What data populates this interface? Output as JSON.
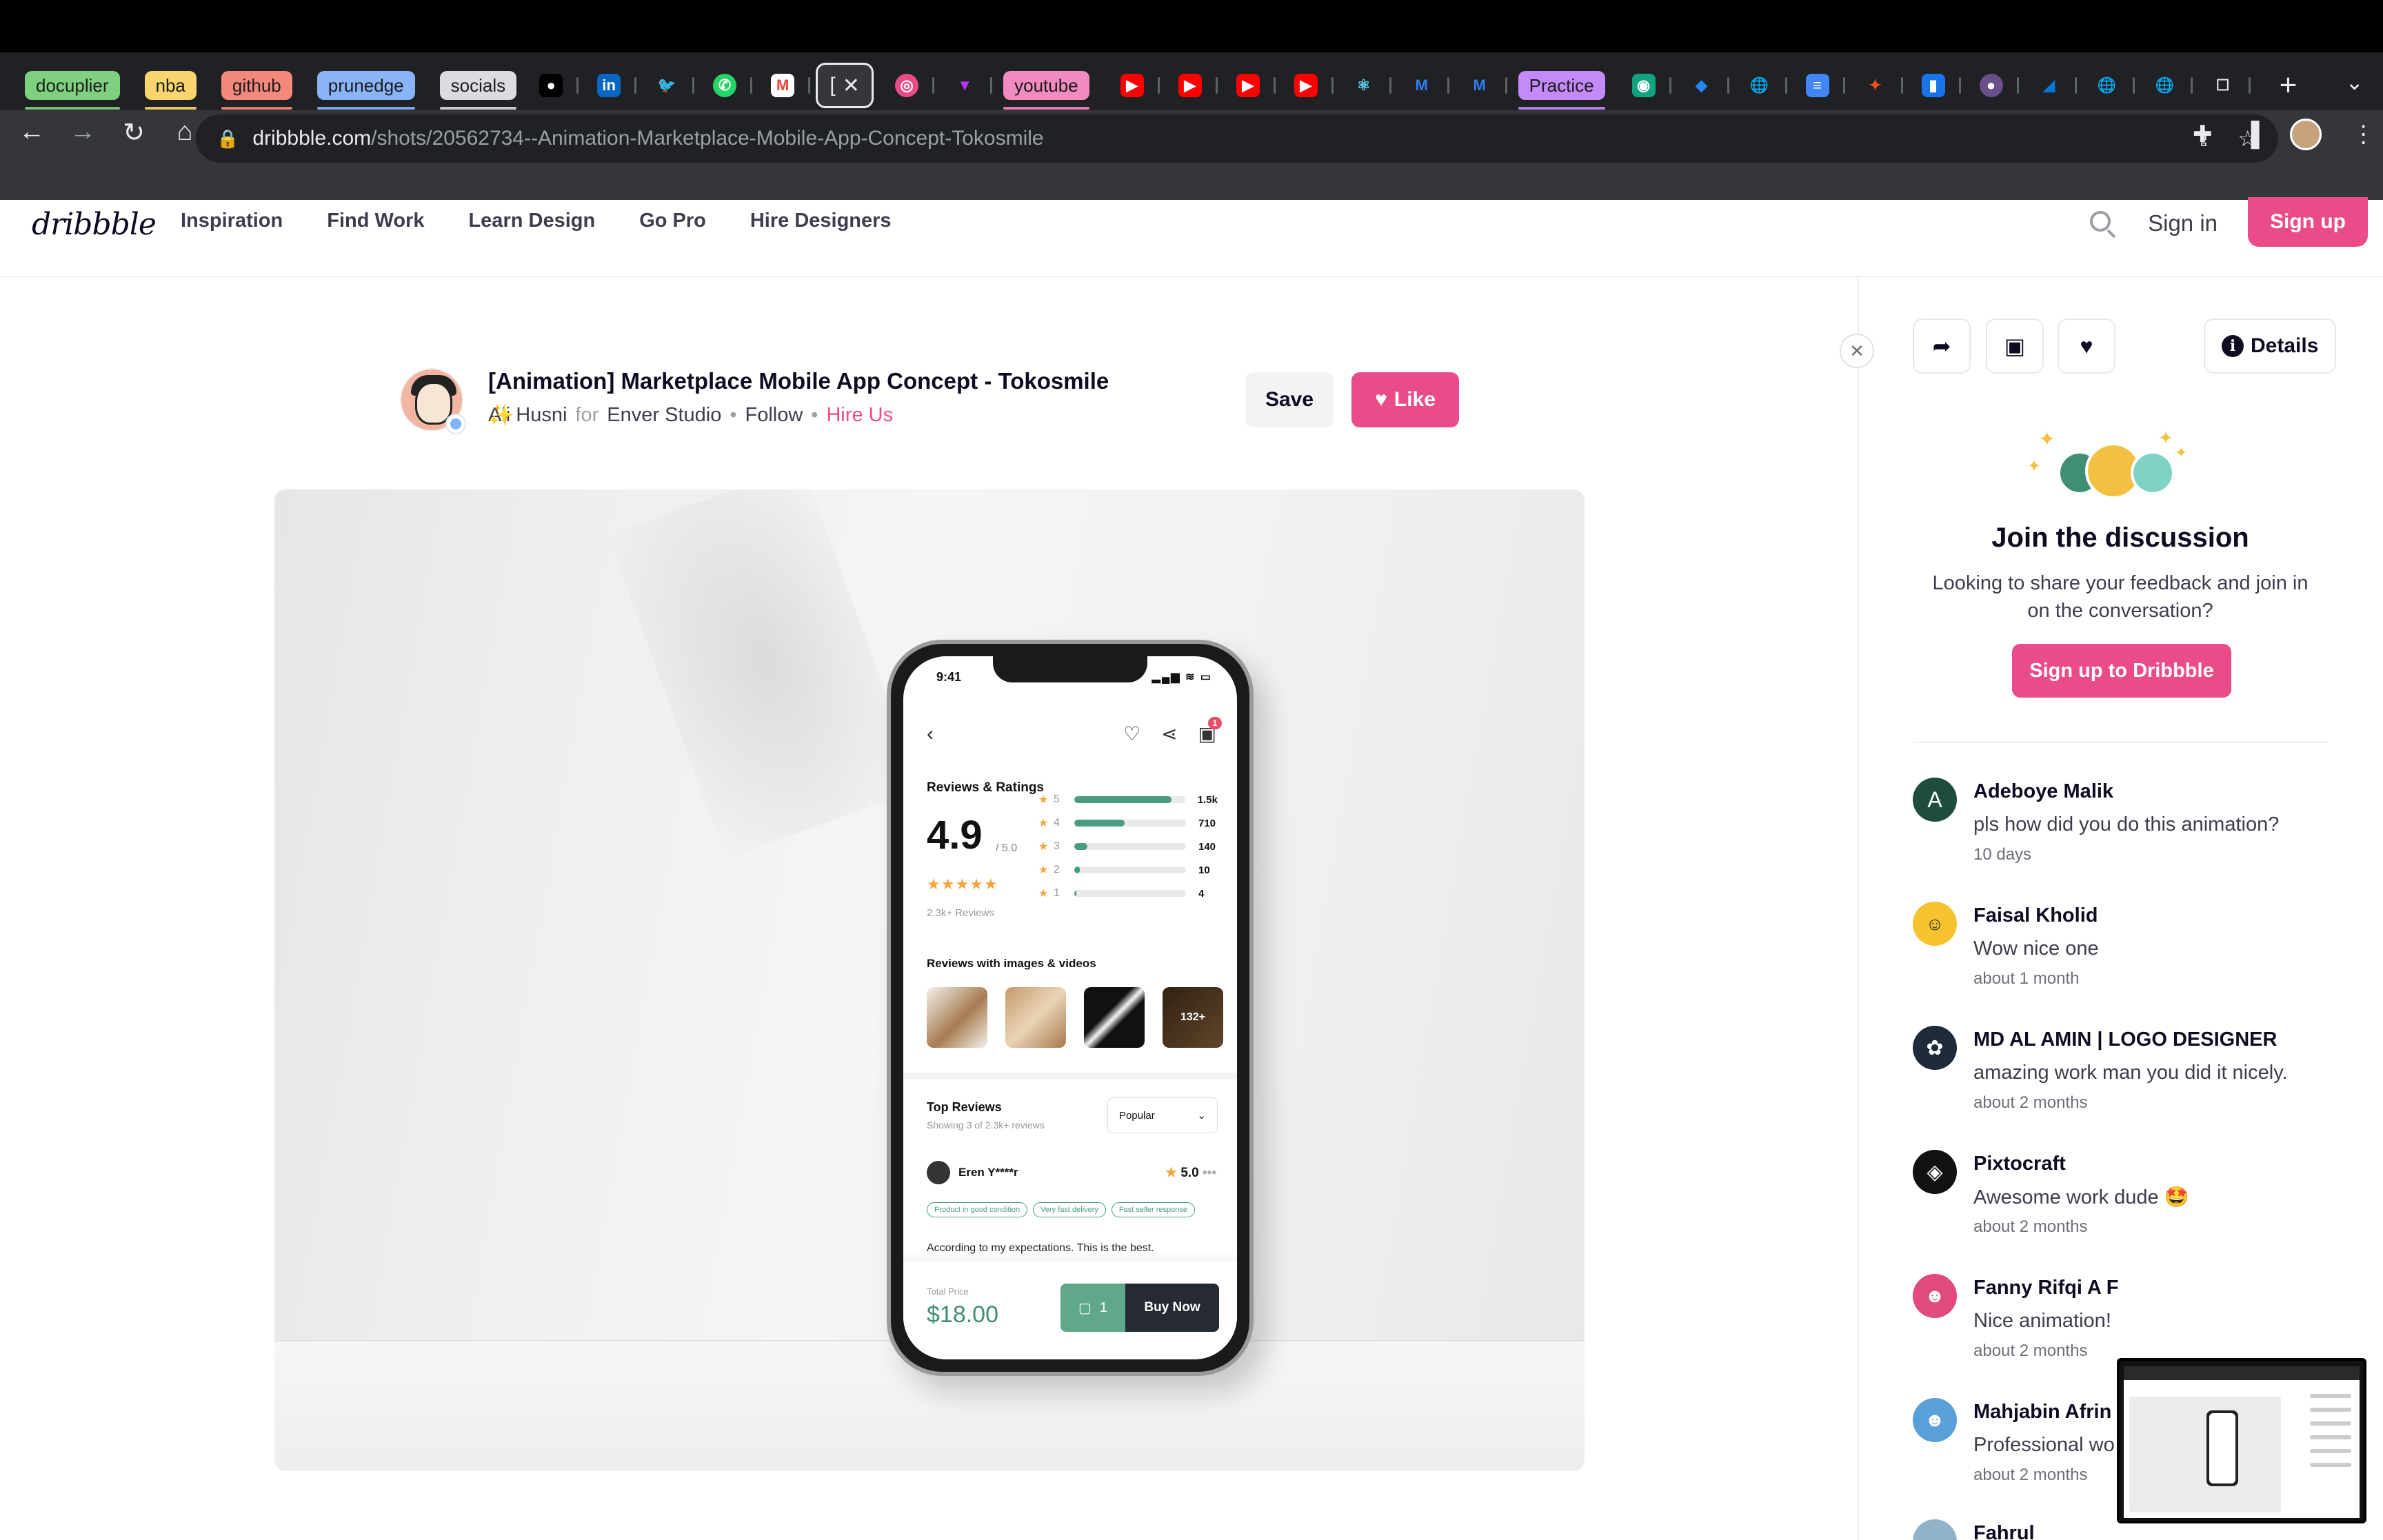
{
  "browser": {
    "tab_groups": [
      {
        "label": "docuplier",
        "color": "#7fd17f"
      },
      {
        "label": "nba",
        "color": "#f9d56e"
      },
      {
        "label": "github",
        "color": "#f4887c"
      },
      {
        "label": "prunedge",
        "color": "#8ab4f8"
      },
      {
        "label": "socials",
        "color": "#dadce0"
      },
      {
        "label": "youtube",
        "color": "#f28bc0"
      },
      {
        "label": "Practice",
        "color": "#c58af9"
      }
    ],
    "active_tab_label": "[",
    "url_domain": "dribbble.com",
    "url_path": "/shots/20562734--Animation-Marketplace-Mobile-App-Concept-Tokosmile"
  },
  "header": {
    "logo": "dribbble",
    "nav": [
      "Inspiration",
      "Find Work",
      "Learn Design",
      "Go Pro",
      "Hire Designers"
    ],
    "sign_in": "Sign in",
    "sign_up": "Sign up"
  },
  "shot": {
    "title": "[Animation] Marketplace Mobile App Concept - Tokosmile",
    "author": "Ali Husni",
    "for_label": "for",
    "team": "Enver Studio",
    "follow": "Follow",
    "hire": "Hire Us",
    "save_label": "Save",
    "like_label": "Like"
  },
  "phone": {
    "time": "9:41",
    "cart_count": "1",
    "reviews_heading": "Reviews & Ratings",
    "rating": "4.9",
    "rating_of": "/ 5.0",
    "reviews_count": "2.3k+ Reviews",
    "rating_bars": [
      {
        "star": "5",
        "count": "1.5k",
        "fill": 0.88
      },
      {
        "star": "4",
        "count": "710",
        "fill": 0.45
      },
      {
        "star": "3",
        "count": "140",
        "fill": 0.12
      },
      {
        "star": "2",
        "count": "10",
        "fill": 0.05
      },
      {
        "star": "1",
        "count": "4",
        "fill": 0.02
      }
    ],
    "media_heading": "Reviews with images & videos",
    "media_more": "132+",
    "top_reviews_heading": "Top Reviews",
    "top_reviews_sub": "Showing 3 of 2.3k+ reviews",
    "sort_label": "Popular",
    "reviewer": "Eren Y****r",
    "review_score": "5.0",
    "tags": [
      "Product in good condition",
      "Very fast delivery",
      "Fast seller response"
    ],
    "review_text": "According to my expectations. This is the best.",
    "total_label": "Total Price",
    "total_value": "$18.00",
    "qty": "1",
    "buy_label": "Buy Now"
  },
  "panel": {
    "details_label": "Details",
    "join_title": "Join the discussion",
    "join_text": "Looking to share your feedback and join in on the conversation?",
    "join_button": "Sign up to Dribbble",
    "comments": [
      {
        "name": "Adeboye Malik",
        "text": "pls how did you do this animation?",
        "time": "10 days",
        "initial": "A",
        "color": "#1e4d3b"
      },
      {
        "name": "Faisal Kholid",
        "text": "Wow nice one",
        "time": "about 1 month",
        "initial": "",
        "color": "#f5c330"
      },
      {
        "name": "MD AL AMIN | LOGO DESIGNER",
        "text": "amazing work man you did it nicely.",
        "time": "about 2 months",
        "initial": "",
        "color": "#1d2b3a"
      },
      {
        "name": "Pixtocraft",
        "text": "Awesome work dude 🤩",
        "time": "about 2 months",
        "initial": "",
        "color": "#111111"
      },
      {
        "name": "Fanny Rifqi A F",
        "text": "Nice animation!",
        "time": "about 2 months",
        "initial": "",
        "color": "#e14a7a"
      },
      {
        "name": "Mahjabin Afrin",
        "text": "Professional wo",
        "time": "about 2 months",
        "initial": "",
        "color": "#5aa0d8"
      },
      {
        "name": "Fahrul",
        "text": "",
        "time": "",
        "initial": "",
        "color": "#8fb3c9"
      }
    ]
  }
}
